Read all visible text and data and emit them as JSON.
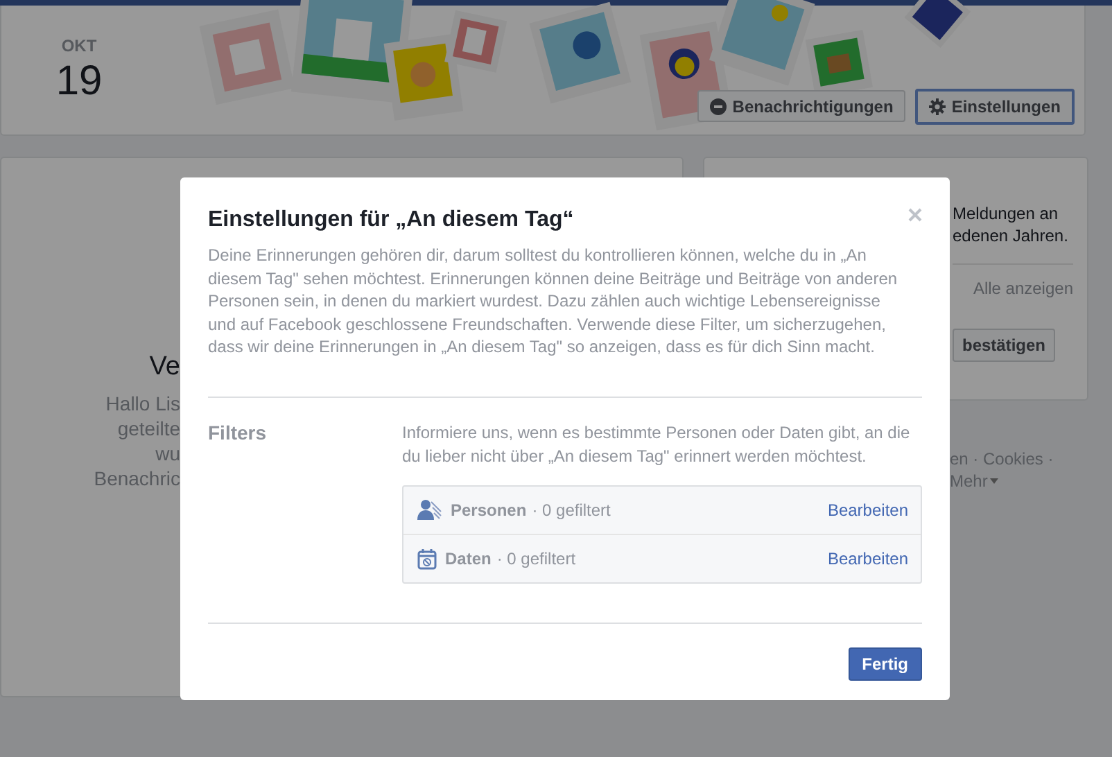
{
  "header": {
    "month": "OKT",
    "day": "19",
    "buttons": [
      {
        "kind": "notifications",
        "label": "Benachrichtigungen",
        "focused": false
      },
      {
        "kind": "settings",
        "label": "Einstellungen",
        "focused": true
      }
    ]
  },
  "main_card": {
    "heading": "Ve",
    "lines": [
      "Hallo Lis",
      "geteilte",
      "wu",
      "Benachric"
    ]
  },
  "side_card": {
    "lines": [
      "Meldungen an",
      "edenen Jahren."
    ],
    "link": "Alle anzeigen",
    "button": "bestätigen"
  },
  "footer": {
    "links": "en · Cookies ·",
    "more": "Mehr"
  },
  "dialog": {
    "title": "Einstellungen für „An diesem Tag“",
    "description": "Deine Erinnerungen gehören dir, darum solltest du kontrollieren können, welche du in „An diesem Tag\" sehen möchtest. Erinnerungen können deine Beiträge und Beiträge von anderen Personen sein, in denen du markiert wurdest. Dazu zählen auch wichtige Lebensereignisse und auf Facebook geschlossene Freundschaften. Verwende diese Filter, um sicherzugehen, dass wir deine Erinnerungen in „An diesem Tag\" so anzeigen, dass es für dich Sinn macht.",
    "filters": {
      "label": "Filters",
      "intro": "Informiere uns, wenn es bestimmte Personen oder Daten gibt, an die du lieber nicht über „An diesem Tag\" erinnert werden möchtest.",
      "rows": [
        {
          "kind": "people",
          "name": "Personen",
          "count": "· 0 gefiltert",
          "action": "Bearbeiten"
        },
        {
          "kind": "dates",
          "name": "Daten",
          "count": "· 0 gefiltert",
          "action": "Bearbeiten"
        }
      ]
    },
    "done_button": "Fertig"
  }
}
